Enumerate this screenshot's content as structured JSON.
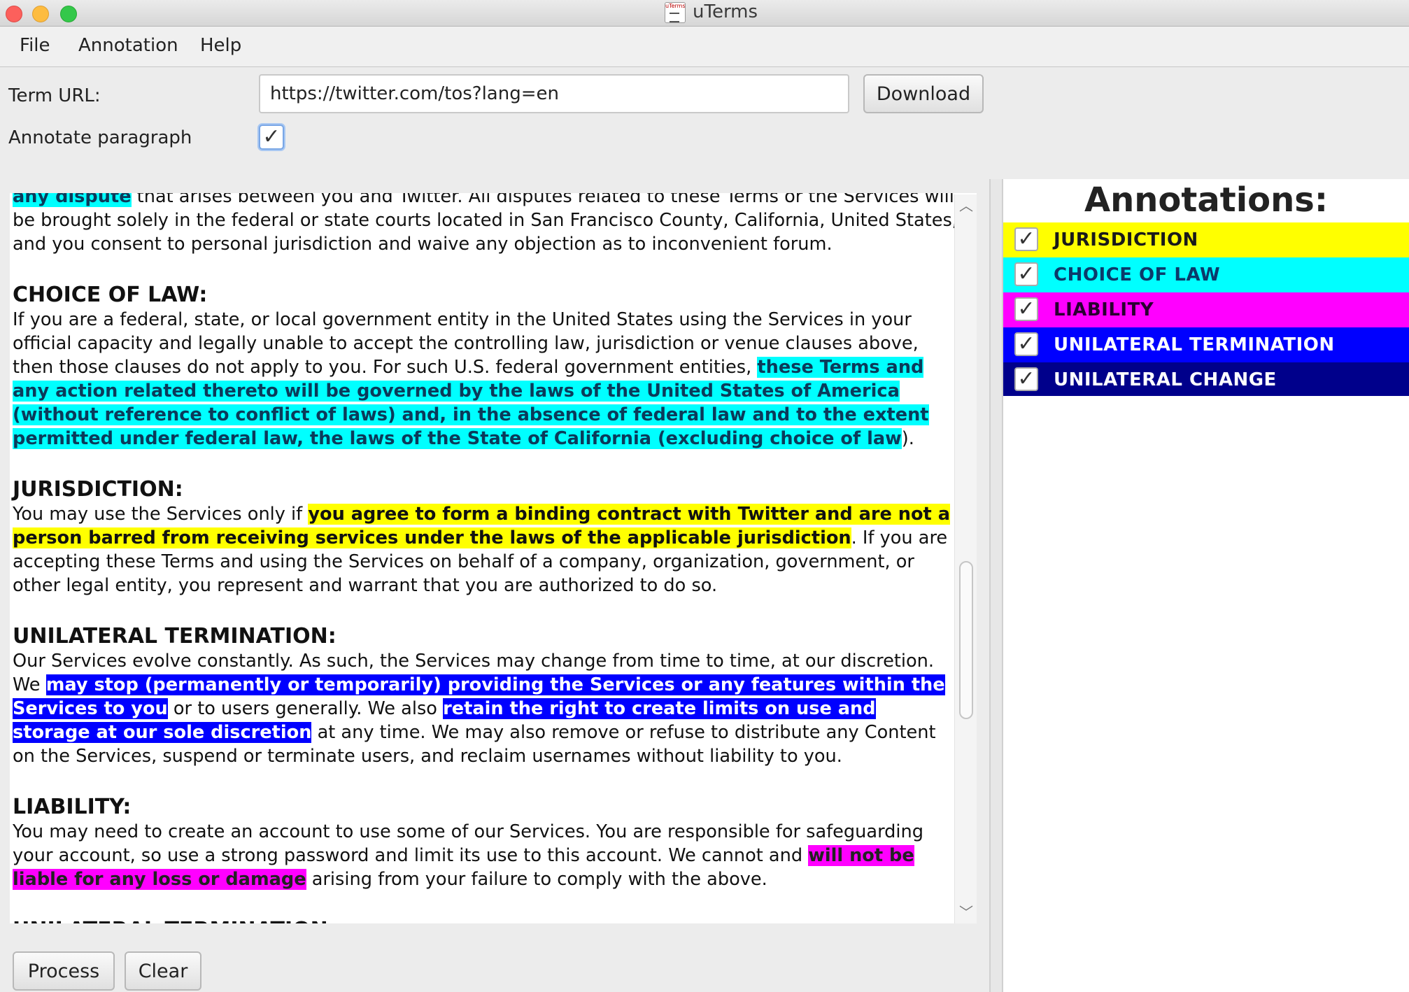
{
  "window": {
    "title": "uTerms",
    "app_icon_text": "uTerms"
  },
  "menu": {
    "items": [
      "File",
      "Annotation",
      "Help"
    ]
  },
  "form": {
    "term_url_label": "Term URL:",
    "term_url_value": "https://twitter.com/tos?lang=en",
    "download_label": "Download",
    "annotate_paragraph_label": "Annotate paragraph",
    "annotate_paragraph_checked": true,
    "check_glyph": "✓"
  },
  "document": {
    "p0_highlight": "any dispute",
    "p0_text": " that arises between you and Twitter. All disputes related to these Terms or the Services will be brought solely in the federal or state courts located in San Francisco County, California, United States, and you consent to personal jurisdiction and waive any objection as to inconvenient forum.",
    "choice_heading": "CHOICE OF LAW:",
    "choice_text_1": "If you are a federal, state, or local government entity in the United States using the Services in your official capacity and legally unable to accept the controlling law, jurisdiction or venue clauses above, then those clauses do not apply to you. For such U.S. federal government entities, ",
    "choice_highlight": "these Terms and any action related thereto will be governed by the laws of the United States of America (without reference to conflict of laws) and, in the absence of federal law and to the extent permitted under federal law, the laws of the State of California (excluding choice of law",
    "choice_text_2": ").",
    "jurisdiction_heading": "JURISDICTION:",
    "jurisdiction_text_1": "You may use the Services only if ",
    "jurisdiction_highlight": "you agree to form a binding contract with Twitter and are not a person barred from receiving services under the laws of the applicable jurisdiction",
    "jurisdiction_text_2": ". If you are accepting these Terms and using the Services on behalf of a company, organization, government, or other legal entity, you represent and warrant that you are authorized to do so.",
    "termination_heading": "UNILATERAL TERMINATION:",
    "termination_text_1": "Our Services evolve constantly. As such, the Services may change from time to time, at our discretion. We ",
    "termination_highlight_1": "may stop (permanently or temporarily) providing the Services or any features within the Services to you",
    "termination_text_2": " or to users generally. We also ",
    "termination_highlight_2": "retain the right to create limits on use and storage at our sole discretion",
    "termination_text_3": " at any time. We may also remove or refuse to distribute any Content on the Services, suspend or terminate users, and reclaim usernames without liability to you.",
    "liability_heading": "LIABILITY:",
    "liability_text_1": "You may need to create an account to use some of our Services. You are responsible for safeguarding your account, so use a strong password and limit its use to this account. We cannot and ",
    "liability_highlight": "will not be liable for any loss or damage",
    "liability_text_2": " arising from your failure to comply with the above.",
    "next_heading": "UNILATERAL TERMINATION:"
  },
  "scrollbar": {
    "up_glyph": "︿",
    "down_glyph": "﹀"
  },
  "buttons": {
    "process_label": "Process",
    "clear_label": "Clear"
  },
  "annotations": {
    "title": "Annotations:",
    "items": [
      {
        "label": "JURISDICTION",
        "bg": "#ffff00",
        "fg": "#1a1a1a",
        "checked": true
      },
      {
        "label": "CHOICE OF LAW",
        "bg": "#00ffff",
        "fg": "#0b3a6a",
        "checked": true
      },
      {
        "label": "LIABILITY",
        "bg": "#ff00ff",
        "fg": "#2a0030",
        "checked": true
      },
      {
        "label": "UNILATERAL TERMINATION",
        "bg": "#0000ff",
        "fg": "#ffffff",
        "checked": true
      },
      {
        "label": "UNILATERAL CHANGE",
        "bg": "#00008b",
        "fg": "#ffffff",
        "checked": true
      }
    ]
  }
}
